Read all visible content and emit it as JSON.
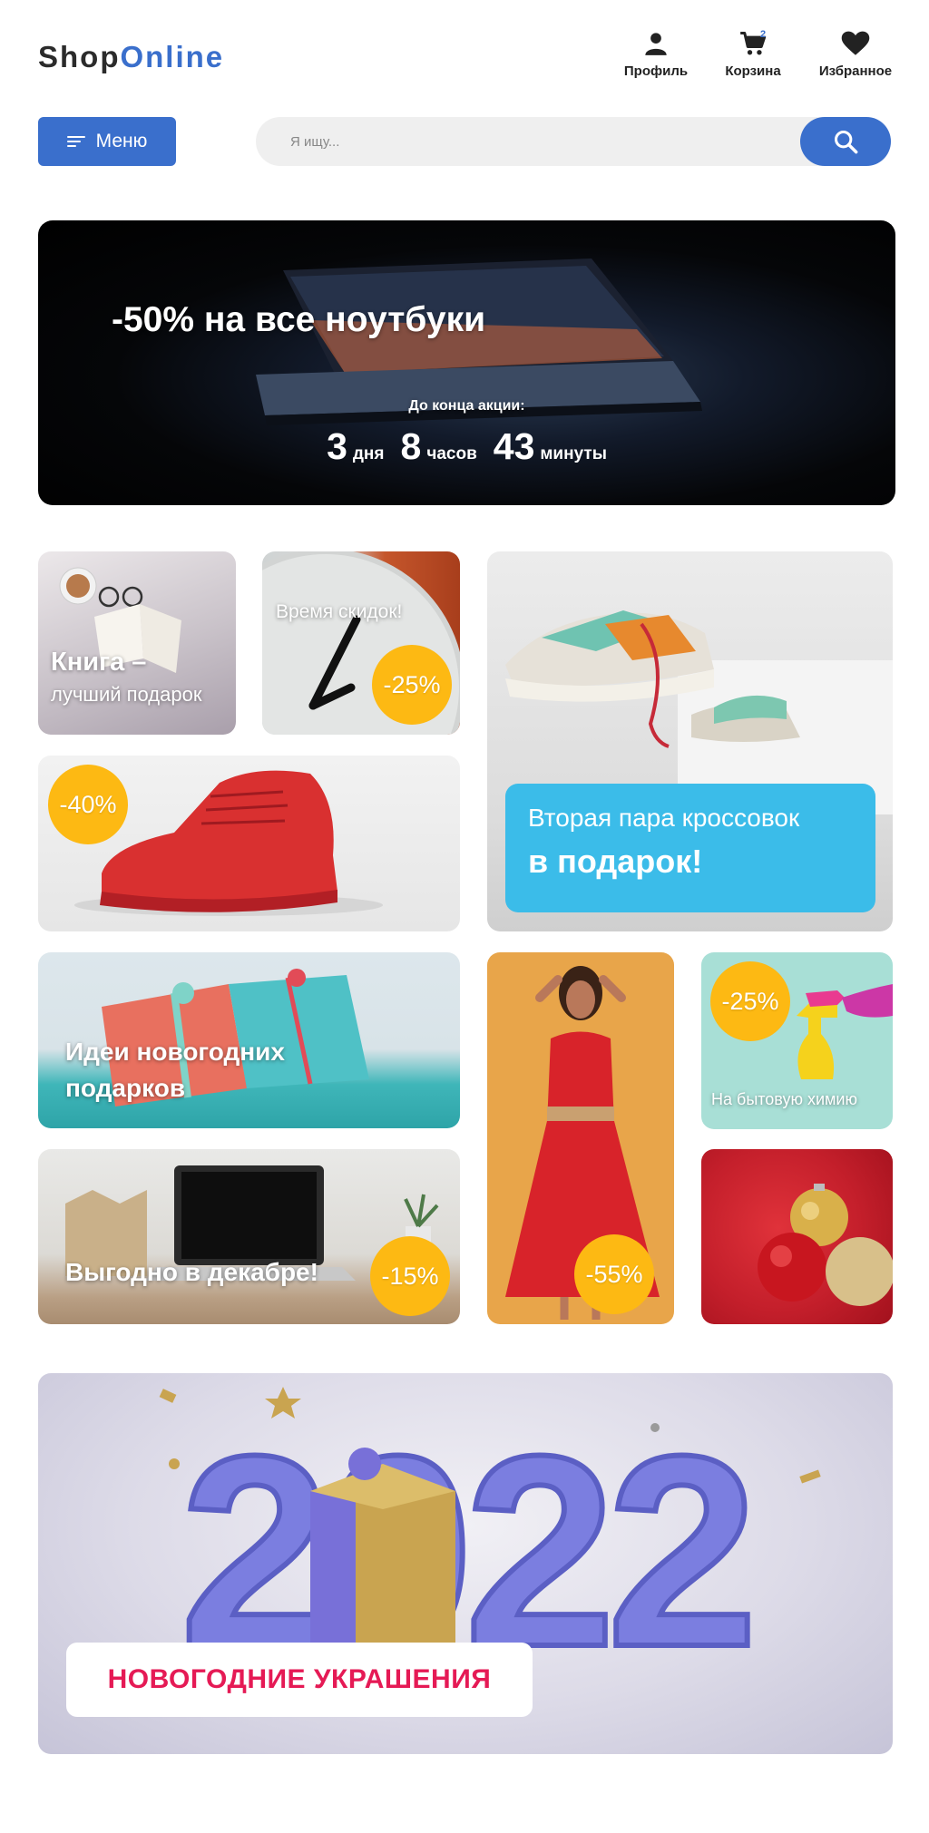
{
  "header": {
    "logo_part1": "Shop",
    "logo_part2": "Online",
    "profile_label": "Профиль",
    "cart_label": "Корзина",
    "cart_count": "2",
    "favorites_label": "Избранное"
  },
  "toolbar": {
    "menu_label": "Меню",
    "search_placeholder": "Я ищу..."
  },
  "hero": {
    "title": "-50% на все ноутбуки",
    "subtitle": "До конца акции:",
    "days_value": "3",
    "days_unit": "дня",
    "hours_value": "8",
    "hours_unit": "часов",
    "minutes_value": "43",
    "minutes_unit": "минуты"
  },
  "tiles": {
    "book": {
      "line1": "Книга –",
      "line2": "лучший подарок"
    },
    "clock": {
      "label": "Время скидок!",
      "discount": "-25%"
    },
    "sneakers_pair": {
      "line1": "Вторая пара кроссовок",
      "line2": "в подарок!"
    },
    "red_sneaker": {
      "discount": "-40%"
    },
    "gifts": {
      "line1": "Идеи новогодних",
      "line2": "подарков"
    },
    "desk": {
      "label": "Выгодно в декабре!",
      "discount": "-15%"
    },
    "dress": {
      "discount": "-55%"
    },
    "chemistry": {
      "discount": "-25%",
      "label": "На бытовую химию"
    },
    "new_year": {
      "label": "НОВОГОДНИЕ УКРАШЕНИЯ",
      "big_text": "2022"
    }
  },
  "colors": {
    "accent_blue": "#3a6fcc",
    "discount_yellow": "#fdb913",
    "promo_cyan": "#3bbce9",
    "new_year_pink": "#e51a55"
  },
  "icons": [
    "user-icon",
    "cart-icon",
    "heart-icon",
    "menu-lines-icon",
    "search-icon"
  ]
}
